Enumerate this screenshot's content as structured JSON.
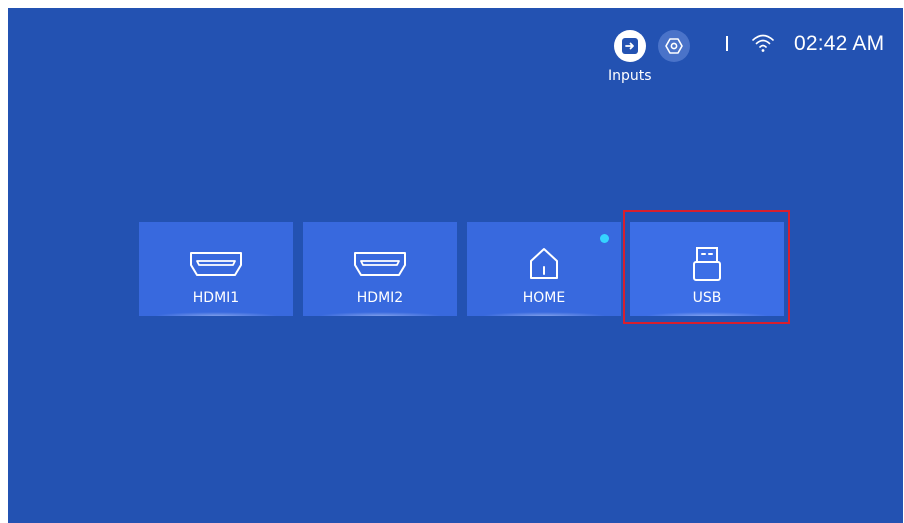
{
  "top_bar": {
    "inputs_label": "Inputs",
    "time": "02:42 AM"
  },
  "sources": [
    {
      "label": "HDMI1",
      "icon": "hdmi-icon"
    },
    {
      "label": "HDMI2",
      "icon": "hdmi-icon"
    },
    {
      "label": "HOME",
      "icon": "home-icon",
      "indicator": "active-dot"
    },
    {
      "label": "USB",
      "icon": "usb-icon",
      "selected": true
    }
  ],
  "colors": {
    "background": "#2352b2",
    "tile": "#3869de",
    "indicator_dot": "#35d4ff",
    "focus_frame": "#d81f2e"
  }
}
